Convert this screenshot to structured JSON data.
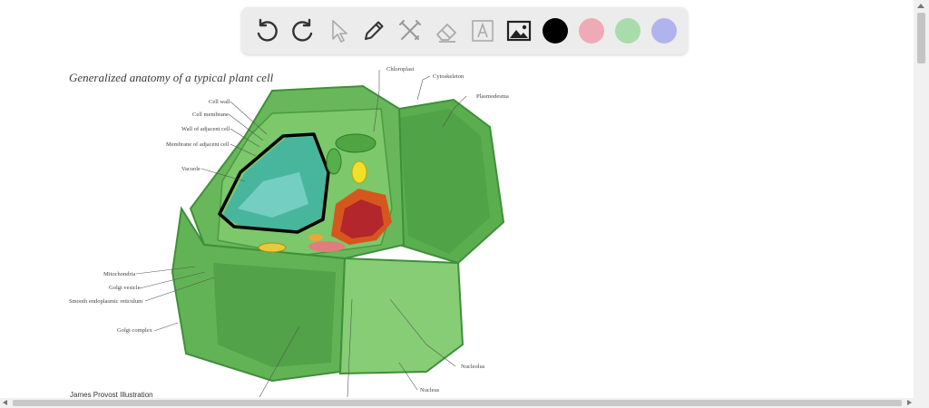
{
  "toolbar": {
    "tools": [
      {
        "name": "undo-icon"
      },
      {
        "name": "redo-icon"
      },
      {
        "name": "pointer-icon"
      },
      {
        "name": "pen-icon"
      },
      {
        "name": "tools-icon"
      },
      {
        "name": "eraser-icon"
      },
      {
        "name": "text-icon"
      },
      {
        "name": "image-icon"
      }
    ],
    "colors": [
      "#000000",
      "#f0aab6",
      "#a8dcaa",
      "#b0b4ee"
    ]
  },
  "diagram": {
    "title": "Generalized anatomy of a typical plant cell",
    "credit": "James Provost Illustration",
    "labels": {
      "cell_wall": "Cell wall",
      "cell_membrane": "Cell membrane",
      "wall_adjacent": "Wall of adjacent cell",
      "membrane_adjacent": "Membrane of adjacent cell",
      "vacuole": "Vacuole",
      "chloroplast": "Chloroplast",
      "cytoskeleton": "Cytoskeleton",
      "plasmodesma": "Plasmodesma",
      "mitochondria": "Mitochondria",
      "golgi_vesicle": "Golgi vesicle",
      "smooth_er": "Smooth endoplasmic reticulum",
      "golgi_complex": "Golgi complex",
      "nucleolus": "Nucleolus",
      "nucleus": "Nucleus"
    },
    "colors": {
      "cell_dark": "#3f8f3a",
      "cell_mid": "#5aae4e",
      "cell_light": "#8fd07f",
      "vacuole": "#3fb3a6",
      "nucleus": "#b3262b"
    }
  }
}
